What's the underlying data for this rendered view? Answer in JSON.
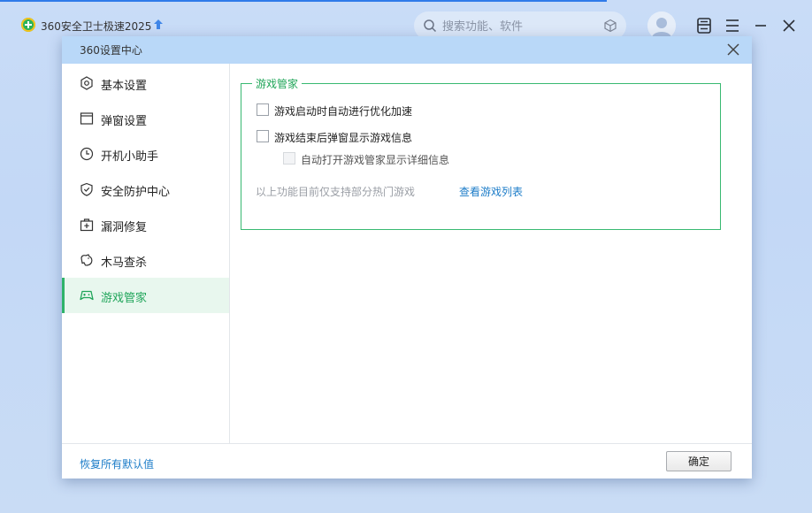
{
  "app": {
    "title": "360安全卫士极速2025",
    "search_placeholder": "搜索功能、软件",
    "accent_color": "#2f7be9",
    "brand_color": "#2ab25b"
  },
  "dialog": {
    "title": "360设置中心",
    "sidebar": [
      {
        "label": "基本设置",
        "icon": "hexagon-gear-icon"
      },
      {
        "label": "弹窗设置",
        "icon": "window-icon"
      },
      {
        "label": "开机小助手",
        "icon": "clock-icon"
      },
      {
        "label": "安全防护中心",
        "icon": "shield-check-icon"
      },
      {
        "label": "漏洞修复",
        "icon": "first-aid-kit-icon"
      },
      {
        "label": "木马查杀",
        "icon": "horse-icon"
      },
      {
        "label": "游戏管家",
        "icon": "gamepad-icon",
        "active": true
      }
    ],
    "group": {
      "legend": "游戏管家",
      "options": [
        {
          "label": "游戏启动时自动进行优化加速",
          "checked": false,
          "enabled": true
        },
        {
          "label": "游戏结束后弹窗显示游戏信息",
          "checked": false,
          "enabled": true
        },
        {
          "label": "自动打开游戏管家显示详细信息",
          "checked": false,
          "enabled": false
        }
      ],
      "note": "以上功能目前仅支持部分热门游戏",
      "link": "查看游戏列表"
    },
    "footer": {
      "restore_link": "恢复所有默认值",
      "ok_label": "确定"
    },
    "active_color": "#20a55a"
  }
}
